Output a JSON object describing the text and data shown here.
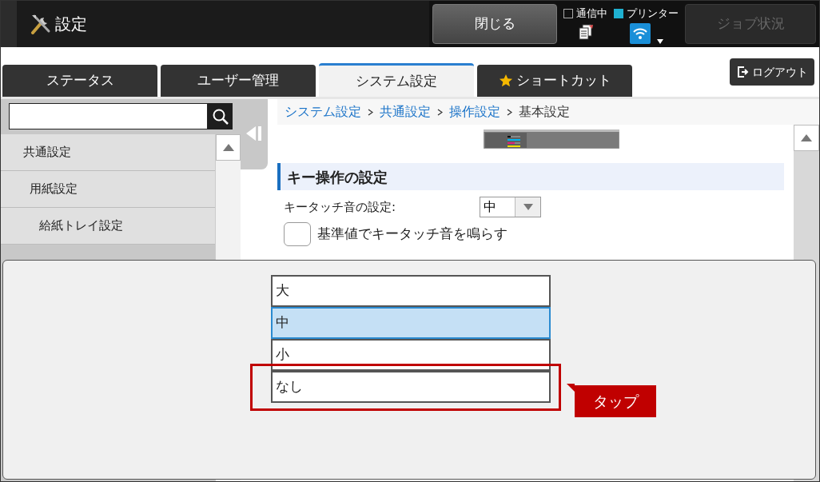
{
  "header": {
    "title": "設定",
    "close_button": "閉じる",
    "indicators": [
      {
        "label": "通信中",
        "on": false,
        "kind": "document"
      },
      {
        "label": "プリンター",
        "on": true,
        "kind": "wifi"
      }
    ],
    "job_status": {
      "label": "ジョブ状況",
      "disabled": true
    }
  },
  "tabs": [
    {
      "label": "ステータス",
      "selected": false,
      "kind": "plain"
    },
    {
      "label": "ユーザー管理",
      "selected": false,
      "kind": "plain"
    },
    {
      "label": "システム設定",
      "selected": true,
      "kind": "plain"
    },
    {
      "label": "ショートカット",
      "selected": false,
      "kind": "star"
    }
  ],
  "logout": "ログアウト",
  "sidebar": {
    "items": [
      {
        "label": "共通設定",
        "children": [
          {
            "label": "用紙設定",
            "children": [
              {
                "label": "給紙トレイ設定"
              }
            ]
          }
        ]
      }
    ]
  },
  "breadcrumb": [
    {
      "label": "システム設定",
      "link": true
    },
    {
      "label": "共通設定",
      "link": true
    },
    {
      "label": "操作設定",
      "link": true
    },
    {
      "label": "基本設定",
      "link": false
    }
  ],
  "section": {
    "title": "キー操作の設定",
    "fields": [
      {
        "kind": "select",
        "label": "キータッチ音の設定:",
        "value": "中"
      },
      {
        "kind": "checkbox",
        "label": "基準値でキータッチ音を鳴らす",
        "checked": false
      }
    ]
  },
  "dropdown": {
    "options": [
      {
        "label": "大",
        "selected": false,
        "tapped": false
      },
      {
        "label": "中",
        "selected": true,
        "tapped": false
      },
      {
        "label": "小",
        "selected": false,
        "tapped": false
      },
      {
        "label": "なし",
        "selected": false,
        "tapped": true
      }
    ],
    "callout": "タップ"
  }
}
